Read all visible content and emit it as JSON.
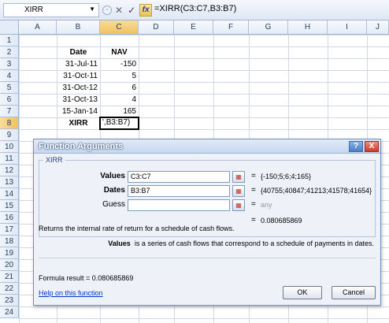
{
  "formula_bar": {
    "name_box": "XIRR",
    "cancel_symbol": "✕",
    "enter_symbol": "✓",
    "fx_label": "fx",
    "formula": "=XIRR(C3:C7,B3:B7)"
  },
  "grid": {
    "columns": [
      "A",
      "B",
      "C",
      "D",
      "E",
      "F",
      "G",
      "H",
      "I",
      "J"
    ],
    "rows": [
      "1",
      "2",
      "3",
      "4",
      "5",
      "6",
      "7",
      "8",
      "9",
      "10",
      "11",
      "12",
      "13",
      "14",
      "15",
      "16",
      "17",
      "18",
      "19",
      "20",
      "21",
      "22",
      "23",
      "24"
    ],
    "header_date": "Date",
    "header_nav": "NAV",
    "dates": [
      "31-Jul-11",
      "31-Oct-11",
      "31-Oct-12",
      "31-Oct-13",
      "15-Jan-14"
    ],
    "navs": [
      "-150",
      "5",
      "6",
      "4",
      "165"
    ],
    "xirr_label": "XIRR",
    "active_cell_text": "',B3:B7)"
  },
  "dialog": {
    "title": "Function Arguments",
    "help_symbol": "?",
    "close_symbol": "X",
    "function_name": "XIRR",
    "args": [
      {
        "label": "Values",
        "value": "C3:C7",
        "result": "{-150;5;6;4;165}"
      },
      {
        "label": "Dates",
        "value": "B3:B7",
        "result": "{40755;40847;41213;41578;41654}"
      },
      {
        "label": "Guess",
        "value": "",
        "result": "any"
      }
    ],
    "ref_symbol": "▦",
    "equals": "=",
    "function_result": "0.080685869",
    "description": "Returns the internal rate of return for a schedule of cash flows.",
    "arg_desc_name": "Values",
    "arg_desc_text": "is a series of cash flows that correspond to a schedule of payments in dates.",
    "formula_result_label": "Formula result =",
    "formula_result_value": "0.080685869",
    "help_link": "Help on this function",
    "ok_label": "OK",
    "cancel_label": "Cancel"
  }
}
